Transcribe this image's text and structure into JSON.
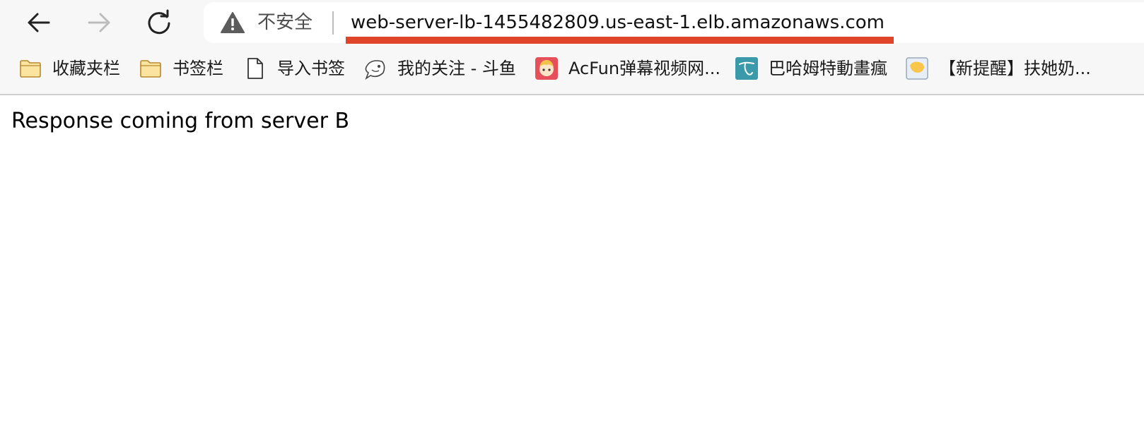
{
  "browser": {
    "security_label": "不安全",
    "url": "web-server-lb-1455482809.us-east-1.elb.amazonaws.com",
    "underline_color": "#e0442a",
    "icons": {
      "back": "back-arrow-icon",
      "forward": "forward-arrow-icon",
      "reload": "reload-icon",
      "security": "warning-triangle-icon"
    }
  },
  "bookmarks": [
    {
      "label": "收藏夹栏",
      "icon": "folder-icon"
    },
    {
      "label": "书签栏",
      "icon": "folder-icon"
    },
    {
      "label": "导入书签",
      "icon": "document-icon"
    },
    {
      "label": "我的关注 - 斗鱼",
      "icon": "douyu-fish-icon"
    },
    {
      "label": "AcFun弹幕视频网...",
      "icon": "acfun-icon"
    },
    {
      "label": "巴哈姆特動畫瘋",
      "icon": "bahamut-icon"
    },
    {
      "label": "【新提醒】扶她奶...",
      "icon": "site-favicon-icon"
    }
  ],
  "page": {
    "body_text": "Response coming from server B"
  }
}
